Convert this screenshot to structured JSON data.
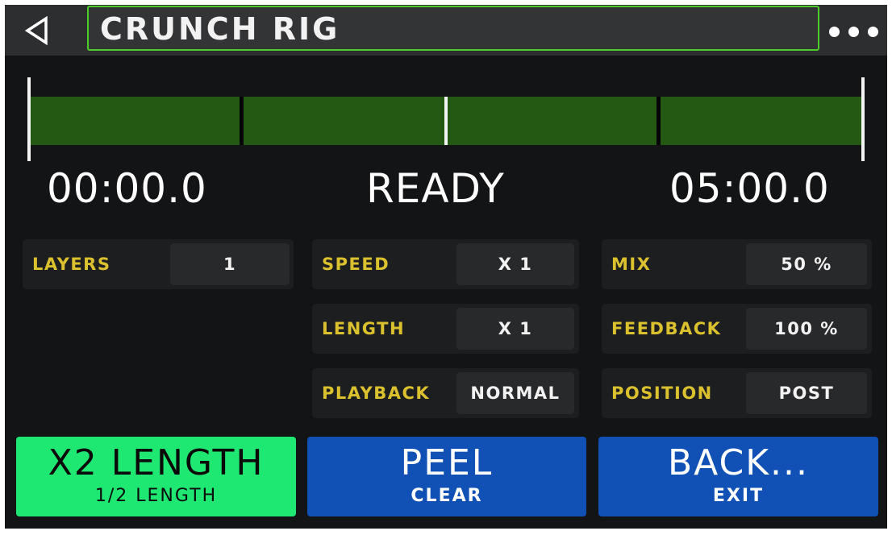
{
  "header": {
    "title": "CRUNCH RIG",
    "back_icon": "back-triangle-icon",
    "menu_icon": "more-dots-icon"
  },
  "colors": {
    "title_border": "#4ccd2a",
    "timeline_fill": "#245914",
    "label_yellow": "#dcc12e",
    "btn_green": "#1ee872",
    "btn_blue": "#1150b5"
  },
  "timeline": {
    "start_time": "00:00.0",
    "status": "READY",
    "end_time": "05:00.0",
    "playhead_fraction": 0.5
  },
  "params": [
    {
      "label": "LAYERS",
      "value": "1"
    },
    {
      "label": "SPEED",
      "value": "X 1"
    },
    {
      "label": "MIX",
      "value": "50 %"
    },
    {
      "label": "LENGTH",
      "value": "X 1"
    },
    {
      "label": "FEEDBACK",
      "value": "100 %"
    },
    {
      "label": "PLAYBACK",
      "value": "NORMAL"
    },
    {
      "label": "POSITION",
      "value": "POST"
    }
  ],
  "actions": [
    {
      "main": "X2 LENGTH",
      "sub": "1/2 LENGTH"
    },
    {
      "main": "PEEL",
      "sub": "CLEAR"
    },
    {
      "main": "BACK...",
      "sub": "EXIT"
    }
  ]
}
